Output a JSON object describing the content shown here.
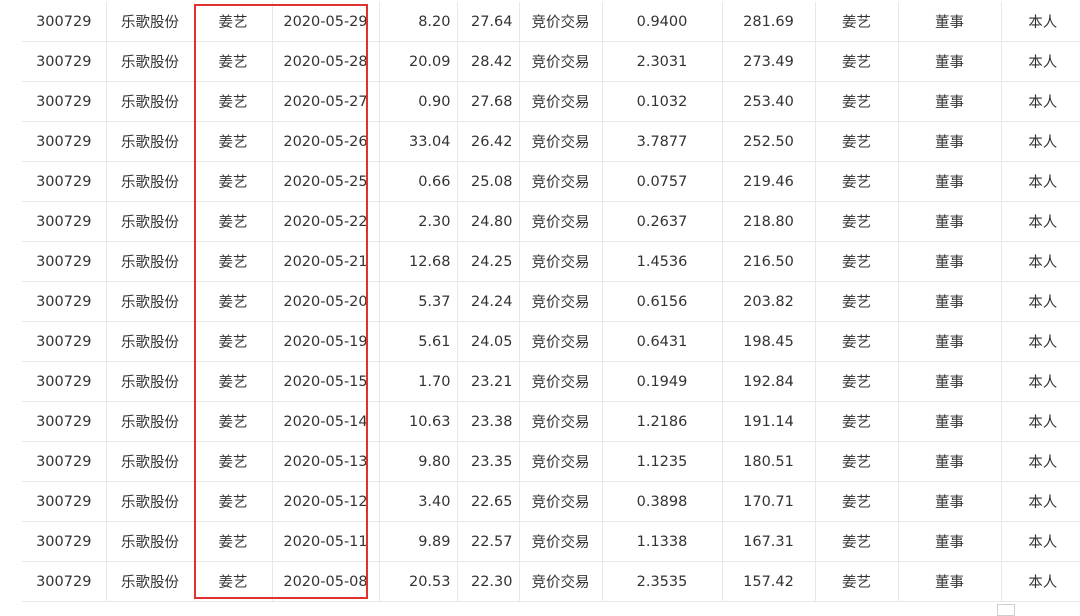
{
  "table": {
    "rows": [
      [
        "300729",
        "乐歌股份",
        "姜艺",
        "2020-05-29",
        "8.20",
        "27.64",
        "竞价交易",
        "0.9400",
        "281.69",
        "姜艺",
        "董事",
        "本人"
      ],
      [
        "300729",
        "乐歌股份",
        "姜艺",
        "2020-05-28",
        "20.09",
        "28.42",
        "竞价交易",
        "2.3031",
        "273.49",
        "姜艺",
        "董事",
        "本人"
      ],
      [
        "300729",
        "乐歌股份",
        "姜艺",
        "2020-05-27",
        "0.90",
        "27.68",
        "竞价交易",
        "0.1032",
        "253.40",
        "姜艺",
        "董事",
        "本人"
      ],
      [
        "300729",
        "乐歌股份",
        "姜艺",
        "2020-05-26",
        "33.04",
        "26.42",
        "竞价交易",
        "3.7877",
        "252.50",
        "姜艺",
        "董事",
        "本人"
      ],
      [
        "300729",
        "乐歌股份",
        "姜艺",
        "2020-05-25",
        "0.66",
        "25.08",
        "竞价交易",
        "0.0757",
        "219.46",
        "姜艺",
        "董事",
        "本人"
      ],
      [
        "300729",
        "乐歌股份",
        "姜艺",
        "2020-05-22",
        "2.30",
        "24.80",
        "竞价交易",
        "0.2637",
        "218.80",
        "姜艺",
        "董事",
        "本人"
      ],
      [
        "300729",
        "乐歌股份",
        "姜艺",
        "2020-05-21",
        "12.68",
        "24.25",
        "竞价交易",
        "1.4536",
        "216.50",
        "姜艺",
        "董事",
        "本人"
      ],
      [
        "300729",
        "乐歌股份",
        "姜艺",
        "2020-05-20",
        "5.37",
        "24.24",
        "竞价交易",
        "0.6156",
        "203.82",
        "姜艺",
        "董事",
        "本人"
      ],
      [
        "300729",
        "乐歌股份",
        "姜艺",
        "2020-05-19",
        "5.61",
        "24.05",
        "竞价交易",
        "0.6431",
        "198.45",
        "姜艺",
        "董事",
        "本人"
      ],
      [
        "300729",
        "乐歌股份",
        "姜艺",
        "2020-05-15",
        "1.70",
        "23.21",
        "竞价交易",
        "0.1949",
        "192.84",
        "姜艺",
        "董事",
        "本人"
      ],
      [
        "300729",
        "乐歌股份",
        "姜艺",
        "2020-05-14",
        "10.63",
        "23.38",
        "竞价交易",
        "1.2186",
        "191.14",
        "姜艺",
        "董事",
        "本人"
      ],
      [
        "300729",
        "乐歌股份",
        "姜艺",
        "2020-05-13",
        "9.80",
        "23.35",
        "竞价交易",
        "1.1235",
        "180.51",
        "姜艺",
        "董事",
        "本人"
      ],
      [
        "300729",
        "乐歌股份",
        "姜艺",
        "2020-05-12",
        "3.40",
        "22.65",
        "竞价交易",
        "0.3898",
        "170.71",
        "姜艺",
        "董事",
        "本人"
      ],
      [
        "300729",
        "乐歌股份",
        "姜艺",
        "2020-05-11",
        "9.89",
        "22.57",
        "竞价交易",
        "1.1338",
        "167.31",
        "姜艺",
        "董事",
        "本人"
      ],
      [
        "300729",
        "乐歌股份",
        "姜艺",
        "2020-05-08",
        "20.53",
        "22.30",
        "竞价交易",
        "2.3535",
        "157.42",
        "姜艺",
        "董事",
        "本人"
      ]
    ]
  },
  "highlight": {
    "color": "#e0312f"
  },
  "icons": {
    "corner": "image-placeholder-icon"
  }
}
